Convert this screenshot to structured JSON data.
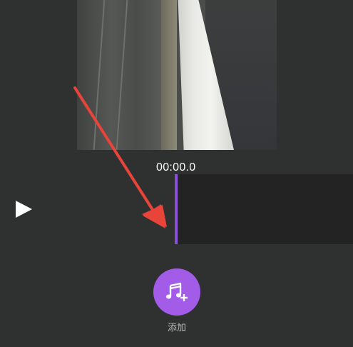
{
  "player": {
    "timecode": "00:00.0",
    "play_icon": "play-icon"
  },
  "add_music": {
    "label": "添加",
    "icon": "music-add-icon",
    "accent_color": "#a35ce7"
  },
  "timeline": {
    "playhead_color": "#8a4fd8",
    "track_color": "#232323"
  },
  "annotation": {
    "arrow_color": "#e8443a"
  }
}
